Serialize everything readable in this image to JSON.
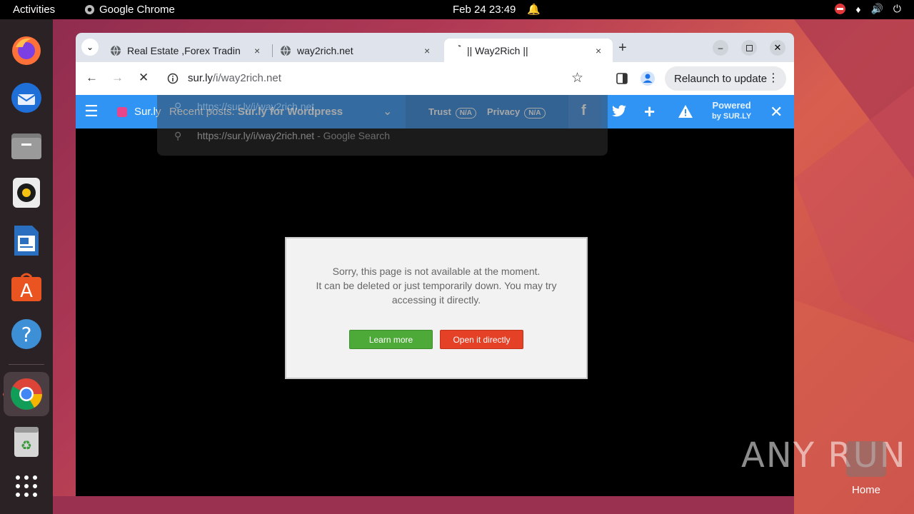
{
  "topbar": {
    "activities": "Activities",
    "app_name": "Google Chrome",
    "clock": "Feb 24  23:49"
  },
  "dock": {
    "items": [
      "firefox-icon",
      "thunderbird-icon",
      "files-icon",
      "rhythmbox-icon",
      "libreoffice-writer-icon",
      "app-center-icon",
      "help-icon",
      "chrome-icon",
      "trash-icon",
      "show-apps-icon"
    ]
  },
  "tabs": [
    {
      "title": "Real Estate ,Forex Tradin",
      "close": "×"
    },
    {
      "title": "way2rich.net",
      "close": "×"
    },
    {
      "title": "|| Way2Rich ||",
      "close": "×"
    }
  ],
  "toolbar": {
    "url_host": "sur.ly",
    "url_path": "/i/way2rich.net",
    "relaunch": "Relaunch to update"
  },
  "suggestions": {
    "first": "https://sur.ly/i/way2rich.net",
    "second": "https://sur.ly/i/way2rich.net",
    "second_suffix": " - Google Search"
  },
  "surly_bar": {
    "brand": "Sur.ly",
    "recent_label": "Recent posts:",
    "recent_value": "Sur.ly for Wordpress",
    "trust_label": "Trust",
    "trust_value": "N/A",
    "privacy_label": "Privacy",
    "privacy_value": "N/A",
    "powered_line1": "Powered",
    "powered_line2": "by SUR.LY"
  },
  "dialog": {
    "line1": "Sorry, this page is not available at the moment.",
    "line2": "It can be deleted or just temporarily down. You may try",
    "line3": "accessing it directly.",
    "learn_more": "Learn more",
    "open_directly": "Open it directly"
  },
  "watermark": {
    "text": "ANY RUN",
    "home_label": "Home"
  }
}
